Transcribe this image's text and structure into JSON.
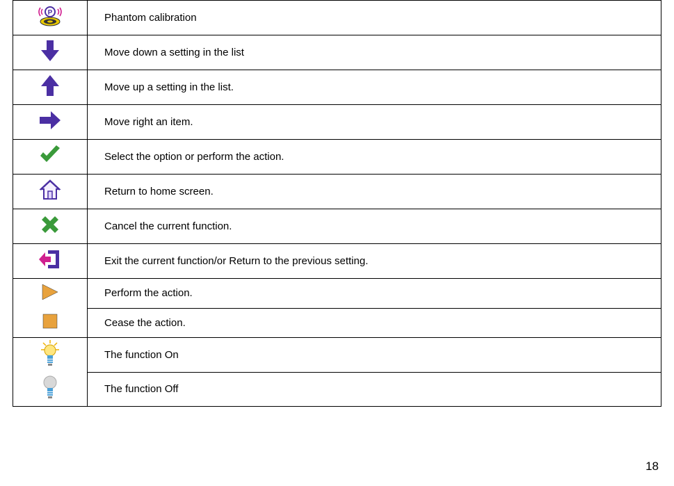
{
  "rows": [
    {
      "icon": "phantom-calibration-icon",
      "desc": "Phantom calibration"
    },
    {
      "icon": "arrow-down-icon",
      "desc": "Move down a setting in the list"
    },
    {
      "icon": "arrow-up-icon",
      "desc": "Move up a setting in the list."
    },
    {
      "icon": "arrow-right-icon",
      "desc": "Move right an item."
    },
    {
      "icon": "checkmark-icon",
      "desc": "Select the option or perform the action."
    },
    {
      "icon": "home-icon",
      "desc": "Return to home screen."
    },
    {
      "icon": "cancel-x-icon",
      "desc": "Cancel the current function."
    },
    {
      "icon": "exit-icon",
      "desc": "Exit the current function/or Return to the previous setting."
    },
    {
      "icon": "play-icon",
      "desc": "Perform the action."
    },
    {
      "icon": "stop-icon",
      "desc": "Cease the action."
    },
    {
      "icon": "bulb-on-icon",
      "desc": "The function On"
    },
    {
      "icon": "bulb-off-icon",
      "desc": "The function Off"
    }
  ],
  "page_number": "18"
}
